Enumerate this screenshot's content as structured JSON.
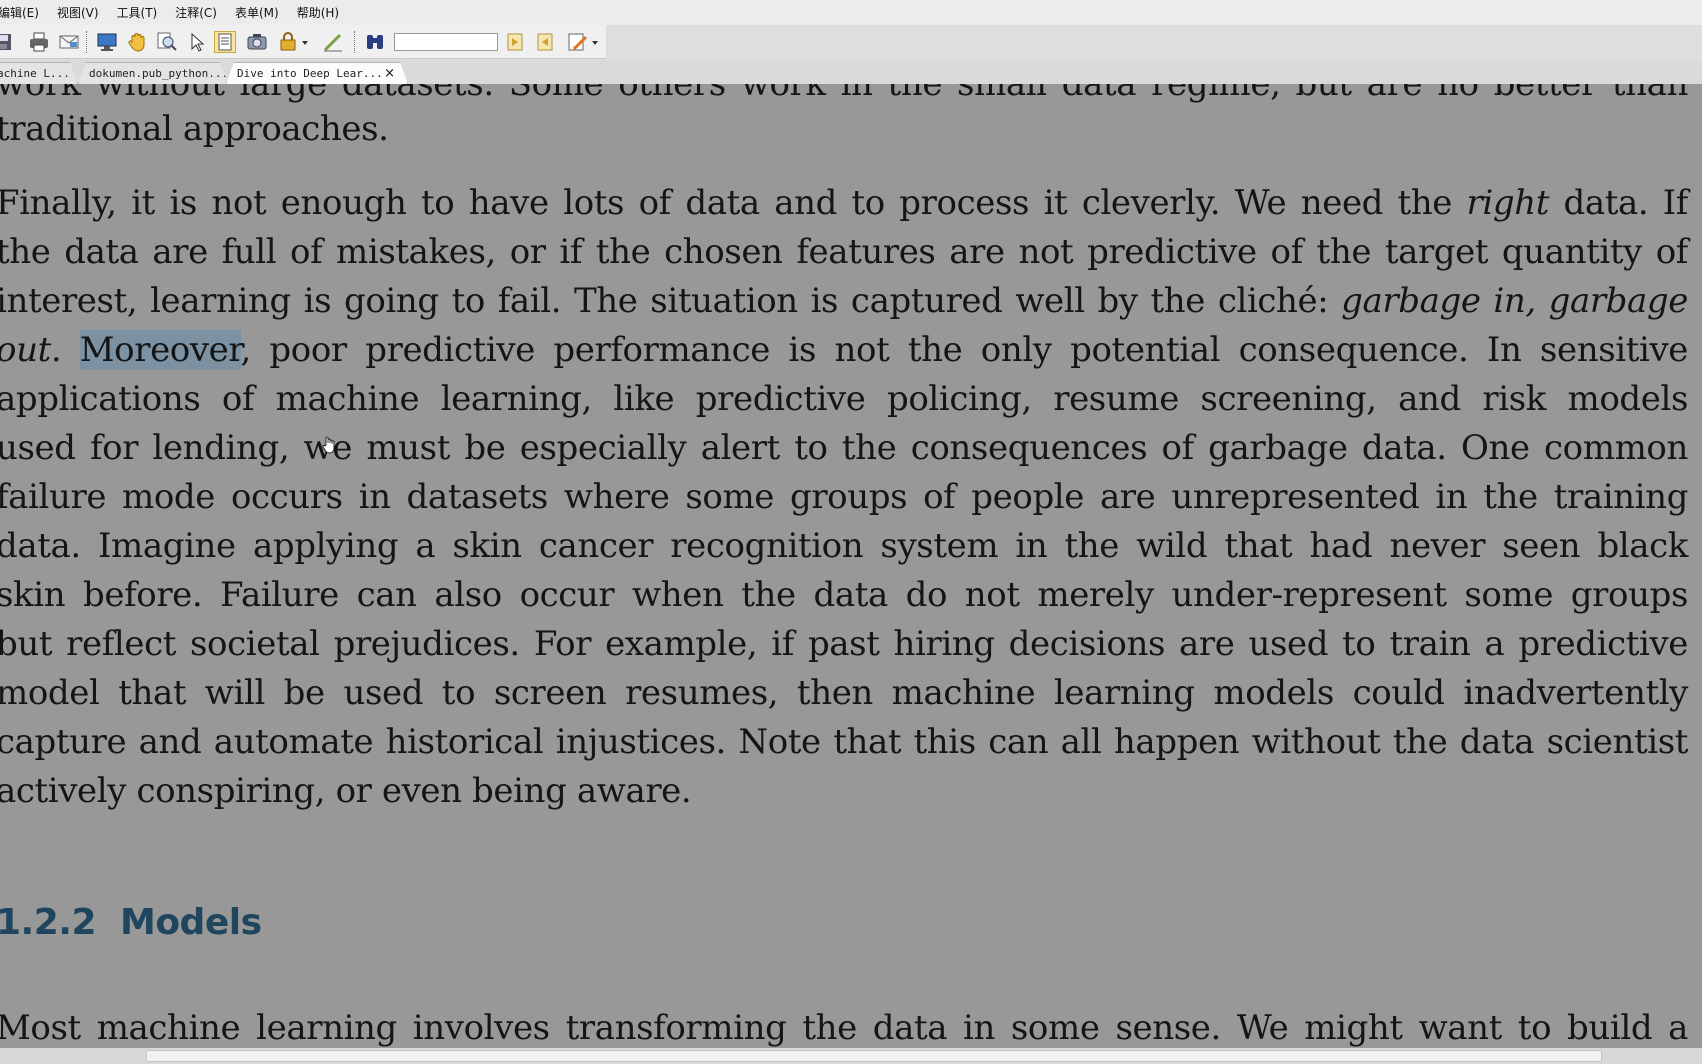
{
  "menubar": {
    "items": [
      "编辑(E)",
      "视图(V)",
      "工具(T)",
      "注释(C)",
      "表单(M)",
      "帮助(H)"
    ]
  },
  "toolbar": {
    "buttons": [
      "save-icon",
      "print-icon",
      "email-icon",
      "fullscreen-icon",
      "hand-tool-icon",
      "zoom-tool-icon",
      "select-arrow-icon",
      "text-select-icon",
      "snapshot-icon",
      "security-icon",
      "sign-icon",
      "find-icon",
      "prev-result-icon",
      "next-result-icon",
      "highlight-icon"
    ],
    "find_value": ""
  },
  "tabs": [
    {
      "label": "achine L...",
      "active": false
    },
    {
      "label": "dokumen.pub_python...",
      "active": false
    },
    {
      "label": "Dive into Deep Lear...",
      "active": true,
      "close": "×"
    }
  ],
  "document": {
    "top_fragment": "work without large datasets. Some others work in the small data regime, but are no better than",
    "p1_end": "traditional approaches.",
    "p2": {
      "l1_a": "Finally, it is not enough to have lots of data and to process it cleverly. We need the ",
      "l1_em": "right",
      "l1_b": " data. If",
      "l2": "the data are full of mistakes, or if the chosen features are not predictive of the target quantity of",
      "l3_a": "interest, learning is going to fail. The situation is captured well by the cliché: ",
      "l3_em": "garbage in, garbage",
      "l4_em": "out",
      "l4_a": ". ",
      "l4_hl": "Moreover",
      "l4_b": ", poor predictive performance is not the only potential consequence. In sensitive",
      "l5": "applications of machine learning, like predictive policing, resume screening, and risk models",
      "l6": "used for lending, we must be especially alert to the consequences of garbage data. One common",
      "l7": "failure mode occurs in datasets where some groups of people are unrepresented in the training",
      "l8": "data. Imagine applying a skin cancer recognition system in the wild that had never seen black",
      "l9": "skin before. Failure can also occur when the data do not merely under-represent some groups",
      "l10": "but reflect societal prejudices. For example, if past hiring decisions are used to train a predictive",
      "l11": "model that will be used to screen resumes, then machine learning models could inadvertently",
      "l12": "capture and automate historical injustices. Note that this can all happen without the data scientist",
      "l13": "actively conspiring, or even being aware."
    },
    "heading": {
      "number": "1.2.2",
      "title": "Models"
    },
    "p3_l1": "Most machine learning involves transforming the data in some sense. We might want to build a"
  },
  "colors": {
    "page_background": "#989898",
    "selection_highlight": "#5c8caf",
    "heading_color": "#20455e"
  }
}
